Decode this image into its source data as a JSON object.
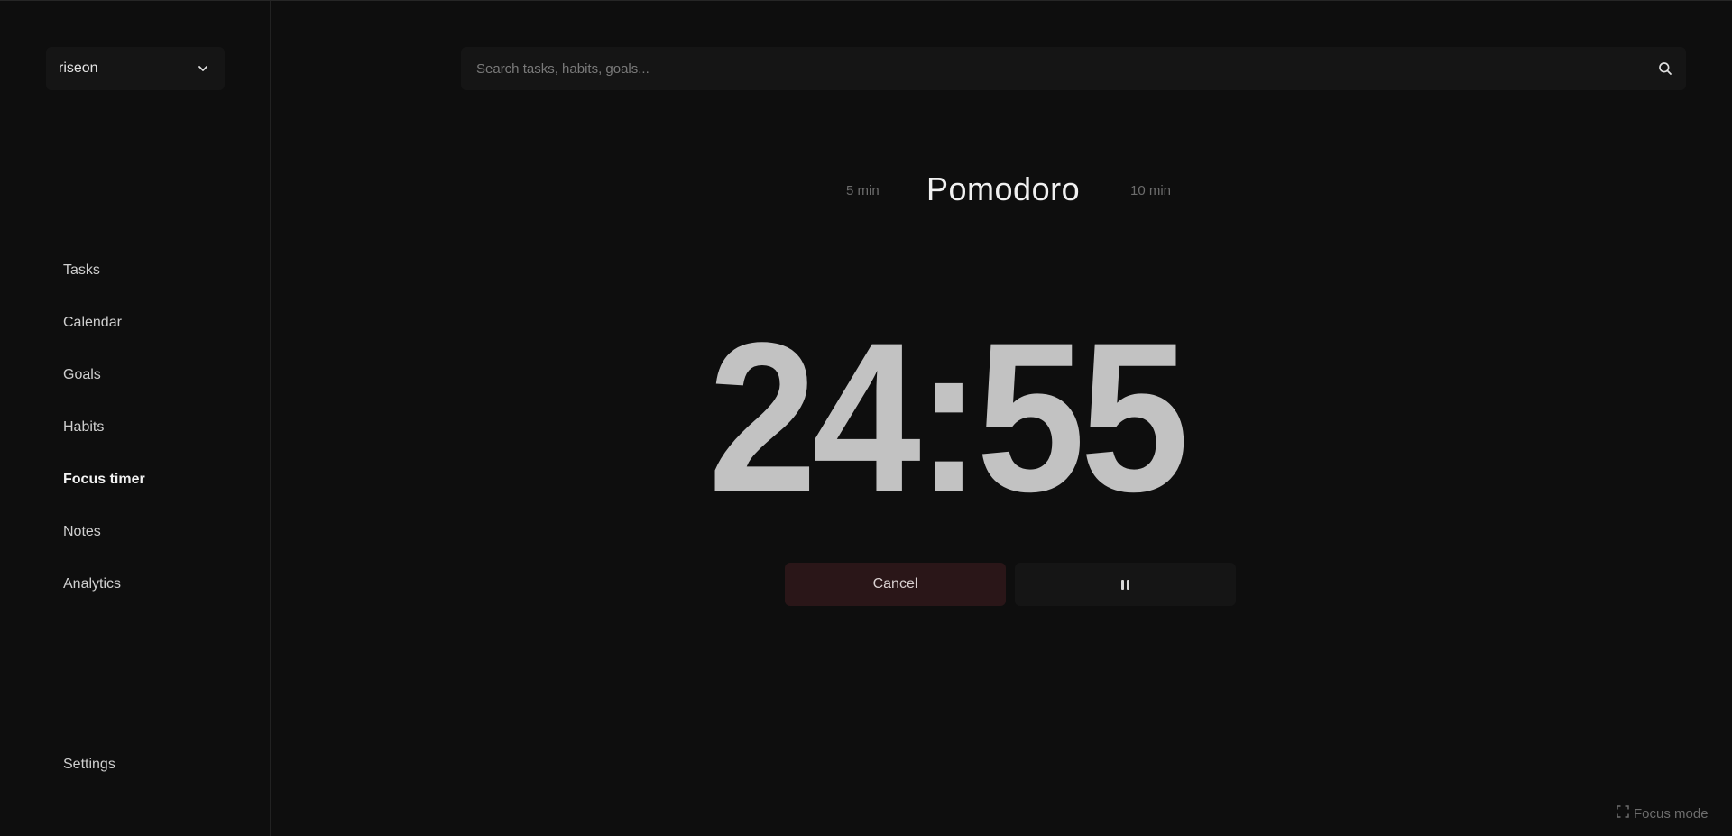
{
  "sidebar": {
    "workspace": {
      "name": "riseon",
      "icon": "chevron-down-icon"
    },
    "items": [
      {
        "label": "Tasks",
        "active": false
      },
      {
        "label": "Calendar",
        "active": false
      },
      {
        "label": "Goals",
        "active": false
      },
      {
        "label": "Habits",
        "active": false
      },
      {
        "label": "Focus timer",
        "active": true
      },
      {
        "label": "Notes",
        "active": false
      },
      {
        "label": "Analytics",
        "active": false
      }
    ],
    "settings_label": "Settings"
  },
  "search": {
    "placeholder": "Search tasks, habits, goals...",
    "value": "",
    "icon": "search-icon"
  },
  "timer": {
    "modes": {
      "previous": "5 min",
      "current": "Pomodoro",
      "next": "10 min"
    },
    "display": "24:55",
    "cancel_label": "Cancel",
    "pause_icon": "pause-icon"
  },
  "footer": {
    "focus_mode_label": "Focus mode",
    "focus_mode_icon": "fullscreen-icon"
  },
  "colors": {
    "background": "#0e0e0e",
    "panel": "#151515",
    "cancel_bg": "#2a1618",
    "timer_text": "#c2c2c2"
  }
}
